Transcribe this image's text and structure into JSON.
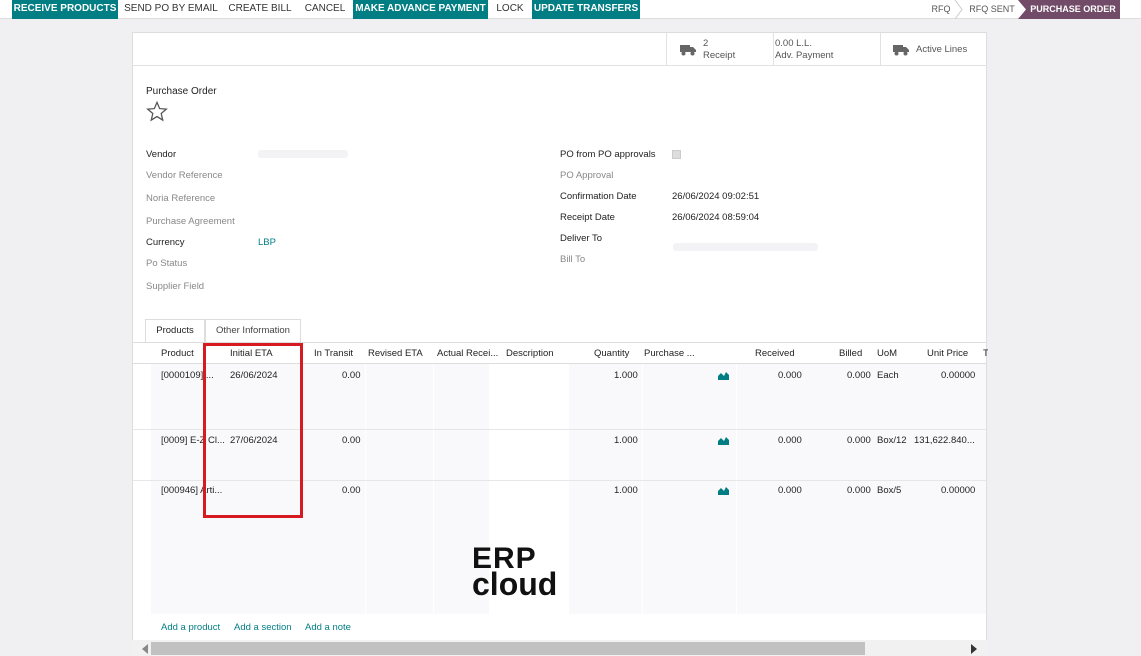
{
  "toolbar": {
    "receive_products": "RECEIVE PRODUCTS",
    "send_po_by_email": "SEND PO BY EMAIL",
    "create_bill": "CREATE BILL",
    "cancel": "CANCEL",
    "make_advance_payment": "MAKE ADVANCE PAYMENT",
    "lock": "LOCK",
    "update_transfers": "UPDATE TRANSFERS"
  },
  "statusbar": {
    "stages": [
      "RFQ",
      "RFQ SENT",
      "PURCHASE ORDER"
    ],
    "current": "PURCHASE ORDER"
  },
  "smart_buttons": {
    "receipt_count": "2",
    "receipt_label": "Receipt",
    "adv_payment_amount": "0.00 L.L.",
    "adv_payment_label": "Adv. Payment",
    "active_lines_label": "Active Lines"
  },
  "form": {
    "title": "Purchase Order",
    "left_fields": {
      "vendor": "Vendor",
      "vendor_reference": "Vendor Reference",
      "noria_reference": "Noria Reference",
      "purchase_agreement": "Purchase Agreement",
      "currency": "Currency",
      "currency_value": "LBP",
      "po_status": "Po Status",
      "supplier_field": "Supplier Field"
    },
    "right_fields": {
      "po_from_po_approvals": "PO from PO approvals",
      "po_approval": "PO Approval",
      "confirmation_date": "Confirmation Date",
      "confirmation_date_value": "26/06/2024 09:02:51",
      "receipt_date": "Receipt Date",
      "receipt_date_value": "26/06/2024 08:59:04",
      "deliver_to": "Deliver To",
      "bill_to": "Bill To"
    }
  },
  "tabs": [
    "Products",
    "Other Information"
  ],
  "table": {
    "headers": [
      "Product",
      "Initial ETA",
      "In Transit",
      "Revised ETA",
      "Actual Recei...",
      "Description",
      "Quantity",
      "Purchase ...",
      "Received",
      "Billed",
      "UoM",
      "Unit Price",
      "T"
    ],
    "rows": [
      {
        "product": "[0000109] ...",
        "initial_eta": "26/06/2024",
        "in_transit": "0.00",
        "quantity": "1.000",
        "received": "0.000",
        "billed": "0.000",
        "uom": "Each",
        "unit_price": "0.00000"
      },
      {
        "product": "[0009] E-Z Cl...",
        "initial_eta": "27/06/2024",
        "in_transit": "0.00",
        "quantity": "1.000",
        "received": "0.000",
        "billed": "0.000",
        "uom": "Box/12",
        "unit_price": "131,622.840..."
      },
      {
        "product": "[000946] Arti...",
        "initial_eta": "",
        "in_transit": "0.00",
        "quantity": "1.000",
        "received": "0.000",
        "billed": "0.000",
        "uom": "Box/5",
        "unit_price": "0.00000"
      }
    ],
    "add_product": "Add a product",
    "add_section": "Add a section",
    "add_note": "Add a note"
  },
  "watermark": {
    "line1": "ERP",
    "line2": "cloud"
  },
  "colors": {
    "primary_button": "#017e84",
    "current_stage": "#714b67",
    "highlight_box": "#d71920"
  }
}
